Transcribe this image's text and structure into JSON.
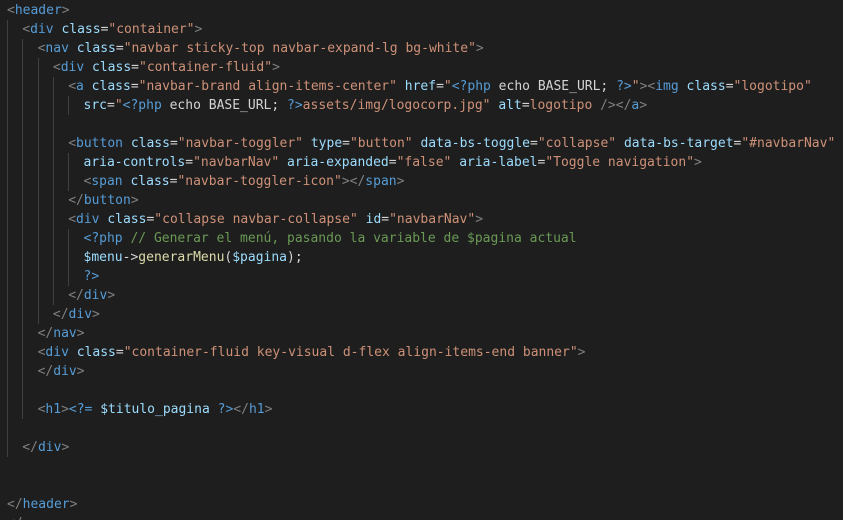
{
  "editor": {
    "language": "php",
    "theme_colors": {
      "background": "#1e1e1e",
      "tag": "#569cd6",
      "punctuation": "#808080",
      "attribute": "#9cdcfe",
      "string": "#ce9178",
      "text": "#d4d4d4",
      "function": "#dcdcaa",
      "comment": "#6a9955"
    },
    "lines": [
      {
        "indent": 0,
        "tokens": [
          [
            "punct",
            "<"
          ],
          [
            "tag",
            "header"
          ],
          [
            "punct",
            ">"
          ]
        ]
      },
      {
        "indent": 1,
        "tokens": [
          [
            "punct",
            "<"
          ],
          [
            "tag",
            "div"
          ],
          [
            "text",
            " "
          ],
          [
            "attr",
            "class"
          ],
          [
            "text",
            "="
          ],
          [
            "str",
            "\"container\""
          ],
          [
            "punct",
            ">"
          ]
        ]
      },
      {
        "indent": 2,
        "tokens": [
          [
            "punct",
            "<"
          ],
          [
            "tag",
            "nav"
          ],
          [
            "text",
            " "
          ],
          [
            "attr",
            "class"
          ],
          [
            "text",
            "="
          ],
          [
            "str",
            "\"navbar sticky-top navbar-expand-lg bg-white\""
          ],
          [
            "punct",
            ">"
          ]
        ]
      },
      {
        "indent": 3,
        "tokens": [
          [
            "punct",
            "<"
          ],
          [
            "tag",
            "div"
          ],
          [
            "text",
            " "
          ],
          [
            "attr",
            "class"
          ],
          [
            "text",
            "="
          ],
          [
            "str",
            "\"container-fluid\""
          ],
          [
            "punct",
            ">"
          ]
        ]
      },
      {
        "indent": 4,
        "tokens": [
          [
            "punct",
            "<"
          ],
          [
            "tag",
            "a"
          ],
          [
            "text",
            " "
          ],
          [
            "attr",
            "class"
          ],
          [
            "text",
            "="
          ],
          [
            "str",
            "\"navbar-brand align-items-center\""
          ],
          [
            "text",
            " "
          ],
          [
            "attr",
            "href"
          ],
          [
            "text",
            "="
          ],
          [
            "str",
            "\""
          ],
          [
            "php",
            "<?php"
          ],
          [
            "text",
            " echo BASE_URL; "
          ],
          [
            "php",
            "?>"
          ],
          [
            "str",
            "\""
          ],
          [
            "punct",
            ">"
          ],
          [
            "punct",
            "<"
          ],
          [
            "tag",
            "img"
          ],
          [
            "text",
            " "
          ],
          [
            "attr",
            "class"
          ],
          [
            "text",
            "="
          ],
          [
            "str",
            "\"logotipo\""
          ]
        ]
      },
      {
        "indent": 5,
        "tokens": [
          [
            "attr",
            "src"
          ],
          [
            "text",
            "="
          ],
          [
            "str",
            "\""
          ],
          [
            "php",
            "<?php"
          ],
          [
            "text",
            " echo BASE_URL; "
          ],
          [
            "php",
            "?>"
          ],
          [
            "str",
            "assets/img/logocorp.jpg\""
          ],
          [
            "text",
            " "
          ],
          [
            "attr",
            "alt"
          ],
          [
            "text",
            "="
          ],
          [
            "str",
            "logotipo"
          ],
          [
            "text",
            " "
          ],
          [
            "punct",
            "/>"
          ],
          [
            "punct",
            "</"
          ],
          [
            "tag",
            "a"
          ],
          [
            "punct",
            ">"
          ]
        ]
      },
      {
        "indent": 0,
        "tokens": []
      },
      {
        "indent": 4,
        "tokens": [
          [
            "punct",
            "<"
          ],
          [
            "tag",
            "button"
          ],
          [
            "text",
            " "
          ],
          [
            "attr",
            "class"
          ],
          [
            "text",
            "="
          ],
          [
            "str",
            "\"navbar-toggler\""
          ],
          [
            "text",
            " "
          ],
          [
            "attr",
            "type"
          ],
          [
            "text",
            "="
          ],
          [
            "str",
            "\"button\""
          ],
          [
            "text",
            " "
          ],
          [
            "attr",
            "data-bs-toggle"
          ],
          [
            "text",
            "="
          ],
          [
            "str",
            "\"collapse\""
          ],
          [
            "text",
            " "
          ],
          [
            "attr",
            "data-bs-target"
          ],
          [
            "text",
            "="
          ],
          [
            "str",
            "\"#navbarNav\""
          ]
        ]
      },
      {
        "indent": 5,
        "tokens": [
          [
            "attr",
            "aria-controls"
          ],
          [
            "text",
            "="
          ],
          [
            "str",
            "\"navbarNav\""
          ],
          [
            "text",
            " "
          ],
          [
            "attr",
            "aria-expanded"
          ],
          [
            "text",
            "="
          ],
          [
            "str",
            "\"false\""
          ],
          [
            "text",
            " "
          ],
          [
            "attr",
            "aria-label"
          ],
          [
            "text",
            "="
          ],
          [
            "str",
            "\"Toggle navigation\""
          ],
          [
            "punct",
            ">"
          ]
        ]
      },
      {
        "indent": 5,
        "tokens": [
          [
            "punct",
            "<"
          ],
          [
            "tag",
            "span"
          ],
          [
            "text",
            " "
          ],
          [
            "attr",
            "class"
          ],
          [
            "text",
            "="
          ],
          [
            "str",
            "\"navbar-toggler-icon\""
          ],
          [
            "punct",
            ">"
          ],
          [
            "punct",
            "</"
          ],
          [
            "tag",
            "span"
          ],
          [
            "punct",
            ">"
          ]
        ]
      },
      {
        "indent": 4,
        "tokens": [
          [
            "punct",
            "</"
          ],
          [
            "tag",
            "button"
          ],
          [
            "punct",
            ">"
          ]
        ]
      },
      {
        "indent": 4,
        "tokens": [
          [
            "punct",
            "<"
          ],
          [
            "tag",
            "div"
          ],
          [
            "text",
            " "
          ],
          [
            "attr",
            "class"
          ],
          [
            "text",
            "="
          ],
          [
            "str",
            "\"collapse navbar-collapse\""
          ],
          [
            "text",
            " "
          ],
          [
            "attr",
            "id"
          ],
          [
            "text",
            "="
          ],
          [
            "str",
            "\"navbarNav\""
          ],
          [
            "punct",
            ">"
          ]
        ]
      },
      {
        "indent": 5,
        "tokens": [
          [
            "php",
            "<?php"
          ],
          [
            "text",
            " "
          ],
          [
            "comment",
            "// Generar el menú, pasando la variable de $pagina actual"
          ]
        ]
      },
      {
        "indent": 5,
        "tokens": [
          [
            "var",
            "$menu"
          ],
          [
            "text",
            "->"
          ],
          [
            "fn",
            "generarMenu"
          ],
          [
            "text",
            "("
          ],
          [
            "var",
            "$pagina"
          ],
          [
            "text",
            ");"
          ]
        ]
      },
      {
        "indent": 5,
        "tokens": [
          [
            "php",
            "?>"
          ]
        ]
      },
      {
        "indent": 4,
        "tokens": [
          [
            "punct",
            "</"
          ],
          [
            "tag",
            "div"
          ],
          [
            "punct",
            ">"
          ]
        ]
      },
      {
        "indent": 3,
        "tokens": [
          [
            "punct",
            "</"
          ],
          [
            "tag",
            "div"
          ],
          [
            "punct",
            ">"
          ]
        ]
      },
      {
        "indent": 2,
        "tokens": [
          [
            "punct",
            "</"
          ],
          [
            "tag",
            "nav"
          ],
          [
            "punct",
            ">"
          ]
        ]
      },
      {
        "indent": 2,
        "tokens": [
          [
            "punct",
            "<"
          ],
          [
            "tag",
            "div"
          ],
          [
            "text",
            " "
          ],
          [
            "attr",
            "class"
          ],
          [
            "text",
            "="
          ],
          [
            "str",
            "\"container-fluid key-visual d-flex align-items-end banner\""
          ],
          [
            "punct",
            ">"
          ]
        ]
      },
      {
        "indent": 2,
        "tokens": [
          [
            "punct",
            "</"
          ],
          [
            "tag",
            "div"
          ],
          [
            "punct",
            ">"
          ]
        ]
      },
      {
        "indent": 0,
        "tokens": []
      },
      {
        "indent": 2,
        "tokens": [
          [
            "punct",
            "<"
          ],
          [
            "tag",
            "h1"
          ],
          [
            "punct",
            ">"
          ],
          [
            "php",
            "<?="
          ],
          [
            "text",
            " "
          ],
          [
            "var",
            "$titulo_pagina"
          ],
          [
            "text",
            " "
          ],
          [
            "php",
            "?>"
          ],
          [
            "punct",
            "</"
          ],
          [
            "tag",
            "h1"
          ],
          [
            "punct",
            ">"
          ]
        ]
      },
      {
        "indent": 0,
        "tokens": []
      },
      {
        "indent": 1,
        "tokens": [
          [
            "punct",
            "</"
          ],
          [
            "tag",
            "div"
          ],
          [
            "punct",
            ">"
          ]
        ]
      },
      {
        "indent": 0,
        "tokens": []
      },
      {
        "indent": 0,
        "tokens": []
      },
      {
        "indent": 0,
        "tokens": [
          [
            "punct",
            "</"
          ],
          [
            "tag",
            "header"
          ],
          [
            "punct",
            ">"
          ]
        ]
      },
      {
        "indent": 0,
        "tokens": [
          [
            "punct",
            "</"
          ]
        ]
      }
    ]
  }
}
